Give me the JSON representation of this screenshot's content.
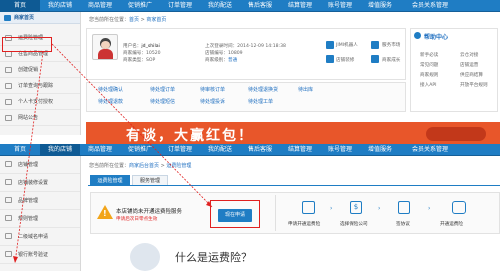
{
  "top_nav": {
    "items": [
      "首页",
      "我的店铺",
      "商品管理",
      "促销推广",
      "订单管理",
      "我的配送",
      "售后客服",
      "结算管理",
      "账号管理",
      "增值服务",
      "会员关系管理"
    ]
  },
  "top_sidebar": {
    "home_label": "商家首页",
    "items": [
      "运费险管理",
      "在售商品管理",
      "创建促销",
      "订单查询与跟踪",
      "个人卡支付授权",
      "网站公告"
    ]
  },
  "top_main": {
    "breadcrumb_prefix": "您当前所在位置：",
    "breadcrumb_home": "首页",
    "breadcrumb_current": "商家首页",
    "profile": {
      "username_label": "用户名：",
      "username": "jd_shilai",
      "shop_id_label": "商家编号：",
      "shop_id": "10520",
      "account_label": "商家类型：",
      "account": "SOP",
      "login_time_label": "上次登录时间：",
      "login_time": "2014-12-09 14:18:38",
      "shop_id2_label": "店铺编号：",
      "shop_id2": "10809",
      "level_label": "商家级别：",
      "level": "普通"
    },
    "quick": [
      "JIMI机器人",
      "服务市场",
      "店铺装修",
      "商家成长"
    ],
    "status_items": [
      "待处理确认",
      "待处理订单",
      "待审核订单",
      "待处理退换货",
      "待出库",
      "待处理退款",
      "待处理短信",
      "待处理投诉",
      "待处理工单"
    ],
    "help_title": "帮助中心",
    "help_links": [
      "新手必读",
      "云仓对接",
      "常见问题",
      "店铺运营",
      "商家规则",
      "供应商结算",
      "接入API",
      "开放平台规则"
    ],
    "banner_text": "有谈，大赢红包！"
  },
  "bottom_nav": {
    "items": [
      "首页",
      "我的店铺",
      "商品管理",
      "促销推广",
      "订单管理",
      "我的配送",
      "售后客服",
      "结算管理",
      "账号管理",
      "增值服务",
      "会员关系管理"
    ]
  },
  "bottom_sidebar": {
    "items": [
      "店铺管理",
      "店铺装修设置",
      "品牌管理",
      "规则管理",
      "二级域名申请",
      "银行账号验证"
    ]
  },
  "bottom_main": {
    "breadcrumb_prefix": "您当前所在位置：",
    "breadcrumb_home": "商家后台首页",
    "breadcrumb_current": "运费险管理",
    "tabs": [
      "运费险管理",
      "服务管理"
    ],
    "notice_text": "本店铺尚未开通运费险服务",
    "notice_sub": "申请后次日零点生效",
    "apply_button": "现在申请",
    "steps": [
      "申请开通运费险",
      "选择保险公司",
      "签协议",
      "开通运费险"
    ],
    "section_title": "什么是运费险？"
  },
  "colors": {
    "nav_blue": "#1f7dc4",
    "highlight_red": "#e02020",
    "banner_orange": "#e8562a"
  }
}
